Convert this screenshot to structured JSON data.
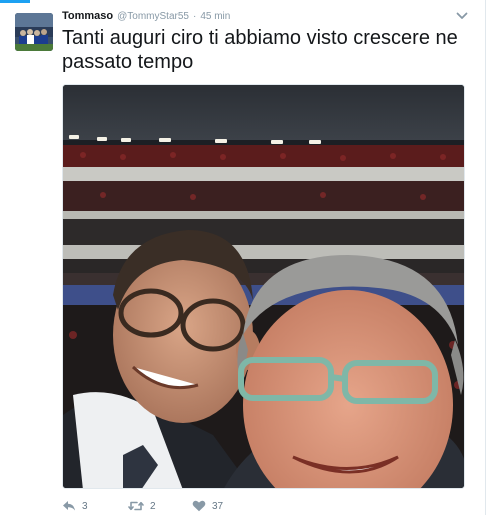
{
  "tweet": {
    "author_name": "Tommaso",
    "screen_name": "@TommyStar55",
    "separator": "·",
    "time": "45 min",
    "text": "Tanti auguri ciro ti abbiamo visto crescere ne passato tempo",
    "reply_count": "3",
    "retweet_count": "2",
    "like_count": "37"
  },
  "icons": {
    "caret": "chevron-down-icon",
    "reply": "reply-icon",
    "retweet": "retweet-icon",
    "like": "heart-icon"
  },
  "colors": {
    "accent": "#1da1f2",
    "muted": "#8899a6",
    "action": "#657786",
    "text": "#14171a"
  }
}
